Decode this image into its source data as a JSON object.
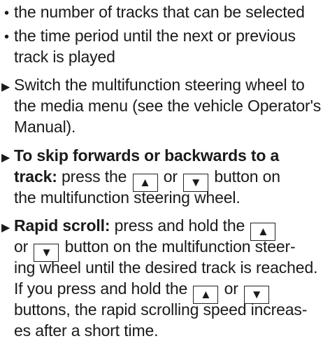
{
  "bullets": [
    "the number of tracks that can be selected",
    "the time period until the next or previous",
    "track is played"
  ],
  "step1": {
    "line1": "Switch the multifunction steering wheel to",
    "line2": "the media menu (see the vehicle Operator's",
    "line3": "Manual)."
  },
  "step2": {
    "bold1": "To skip forwards or backwards to a",
    "bold2": "track:",
    "text2a": " press the ",
    "text2b": " or ",
    "text2c": " button on",
    "line3": "the multifunction steering wheel."
  },
  "step3": {
    "bold1": "Rapid scroll:",
    "text1": " press and hold the ",
    "line2a": "or ",
    "line2b": " button on the multifunction steer-",
    "line3": "ing wheel until the desired track is reached.",
    "line4a": "If you press and hold the ",
    "line4b": " or ",
    "line5a": "buttons, the rapid scrolling speed increas-",
    "line6": "es after a short time."
  },
  "buttons": {
    "up": "▲",
    "down": "▼"
  },
  "glyphs": {
    "bullet": "•",
    "arrow": "▶"
  }
}
